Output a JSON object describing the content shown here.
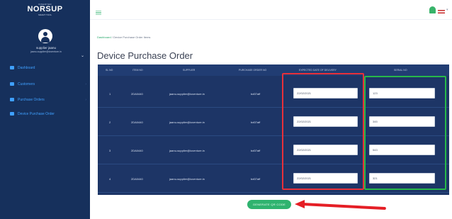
{
  "sidebar": {
    "brand_tagline": "INSERTED",
    "brand_name": "NORSUP",
    "brand_subtitle": "SMART TOOL",
    "user_name": "supplier jaanu",
    "user_email": "jaanu-supplier@iuventure.in",
    "items": [
      {
        "label": "Dashboard",
        "icon": "dashboard-icon"
      },
      {
        "label": "Customers",
        "icon": "customers-icon"
      },
      {
        "label": "Purchase Orders",
        "icon": "purchase-orders-icon"
      },
      {
        "label": "Device Purchase Order",
        "icon": "device-icon"
      }
    ]
  },
  "breadcrumb": {
    "home": "Dashboard",
    "separator": "/",
    "current": "Device Purchase Order Items"
  },
  "page_title": "Device Purchase Order",
  "table": {
    "columns": [
      "SL NO",
      "ITEM NO",
      "SUPPLIER",
      "PURCHASE ORDER NO",
      "EXPECTED DATE OF DELIVERY",
      "SERIAL NO"
    ],
    "rows": [
      {
        "sl": "1",
        "item": "2DA0440",
        "supplier": "jaanu-supplier@iuventure.in",
        "po": "bd07aff",
        "date": "22/02/2021",
        "serial": "123"
      },
      {
        "sl": "2",
        "item": "2DA0440",
        "supplier": "jaanu-supplier@iuventure.in",
        "po": "bd07aff",
        "date": "22/02/2021",
        "serial": "345"
      },
      {
        "sl": "3",
        "item": "2DA0440",
        "supplier": "jaanu-supplier@iuventure.in",
        "po": "bd07aff",
        "date": "22/02/2021",
        "serial": "543"
      },
      {
        "sl": "4",
        "item": "2DA0440",
        "supplier": "jaanu-supplier@iuventure.in",
        "po": "bd07aff",
        "date": "22/02/2021",
        "serial": "321"
      }
    ]
  },
  "generate_button": "GENERATE QR CODE",
  "colors": {
    "sidebar": "#16305c",
    "table": "#1d3566",
    "accent": "#2fb36f",
    "highlight_red": "#e8303a",
    "highlight_green": "#27b84a",
    "arrow": "#e51e25"
  }
}
